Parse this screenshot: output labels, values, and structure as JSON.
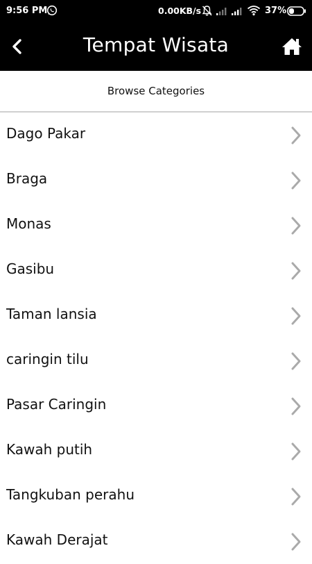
{
  "status_bar": {
    "time": "9:56 PM",
    "net_speed": "0.00KB/s",
    "battery": "37%",
    "icons": [
      "whatsapp-icon",
      "mute-icon",
      "signal-icon",
      "signal-icon",
      "wifi-icon",
      "battery-icon"
    ]
  },
  "app_bar": {
    "title": "Tempat Wisata",
    "back_icon": "chevron-left-icon",
    "home_icon": "home-icon"
  },
  "section": {
    "header": "Browse Categories"
  },
  "categories": [
    {
      "label": "Dago Pakar"
    },
    {
      "label": "Braga"
    },
    {
      "label": "Monas"
    },
    {
      "label": "Gasibu"
    },
    {
      "label": "Taman lansia"
    },
    {
      "label": "caringin tilu"
    },
    {
      "label": "Pasar Caringin"
    },
    {
      "label": "Kawah putih"
    },
    {
      "label": "Tangkuban perahu"
    },
    {
      "label": "Kawah Derajat"
    }
  ],
  "colors": {
    "bar_background": "#000000",
    "bar_text": "#ffffff",
    "list_text": "#111111",
    "chevron": "#aaaaaa",
    "divider": "#d0d0d0"
  }
}
